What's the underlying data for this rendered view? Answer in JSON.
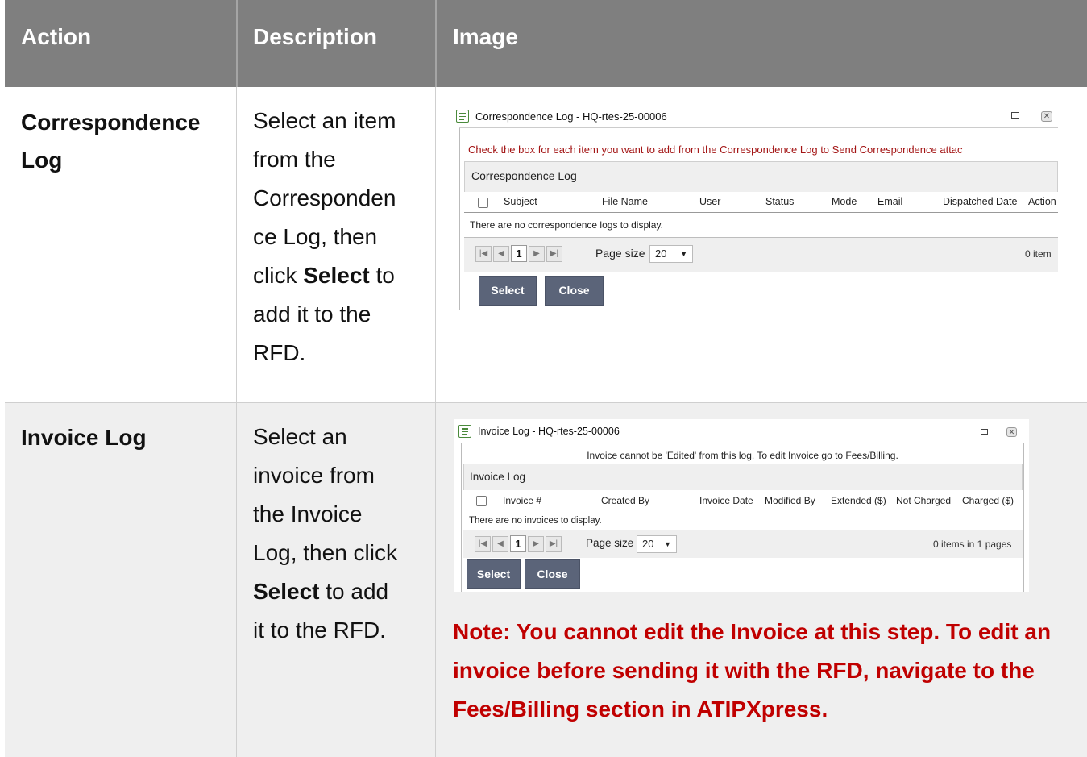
{
  "header": {
    "action": "Action",
    "description": "Description",
    "image": "Image"
  },
  "rows": [
    {
      "action_line1": "Correspondence",
      "action_line2": "Log",
      "desc_lines": [
        "Select an item",
        "from the",
        "Corresponden",
        "ce Log, then"
      ],
      "desc_click": "click ",
      "desc_select": "Select",
      "desc_to": " to",
      "desc_tail": [
        "add it to the",
        "RFD."
      ],
      "dialog": {
        "title": "Correspondence Log - HQ-rtes-25-00006",
        "message": "Check the box for each item you want to add from the Correspondence Log to Send Correspondence attac",
        "section": "Correspondence Log",
        "columns": [
          "Subject",
          "File Name",
          "User",
          "Status",
          "Mode",
          "Email",
          "Dispatched Date",
          "Action"
        ],
        "empty": "There are no correspondence logs to display.",
        "page": "1",
        "page_size_label": "Page size",
        "page_size": "20",
        "info": "0 item",
        "select": "Select",
        "close": "Close"
      }
    },
    {
      "action_line1": "Invoice Log",
      "desc_lines": [
        "Select an",
        "invoice from",
        "the Invoice",
        "Log, then click"
      ],
      "desc_select": "Select",
      "desc_to_add": " to add",
      "desc_tail": [
        "it to the RFD."
      ],
      "dialog": {
        "title": "Invoice Log - HQ-rtes-25-00006",
        "message": "Invoice cannot be 'Edited' from this log. To edit Invoice go to Fees/Billing.",
        "section": "Invoice Log",
        "columns": [
          "Invoice #",
          "Created By",
          "Invoice Date",
          "Modified By",
          "Extended ($)",
          "Not Charged",
          "Charged ($)"
        ],
        "empty": "There are no invoices to display.",
        "page": "1",
        "page_size_label": "Page size",
        "page_size": "20",
        "info": "0 items in 1 pages",
        "select": "Select",
        "close": "Close"
      },
      "note": "Note: You cannot edit the Invoice at this step. To edit an invoice before sending it with the RFD, navigate to the Fees/Billing section in ATIPXpress."
    }
  ]
}
